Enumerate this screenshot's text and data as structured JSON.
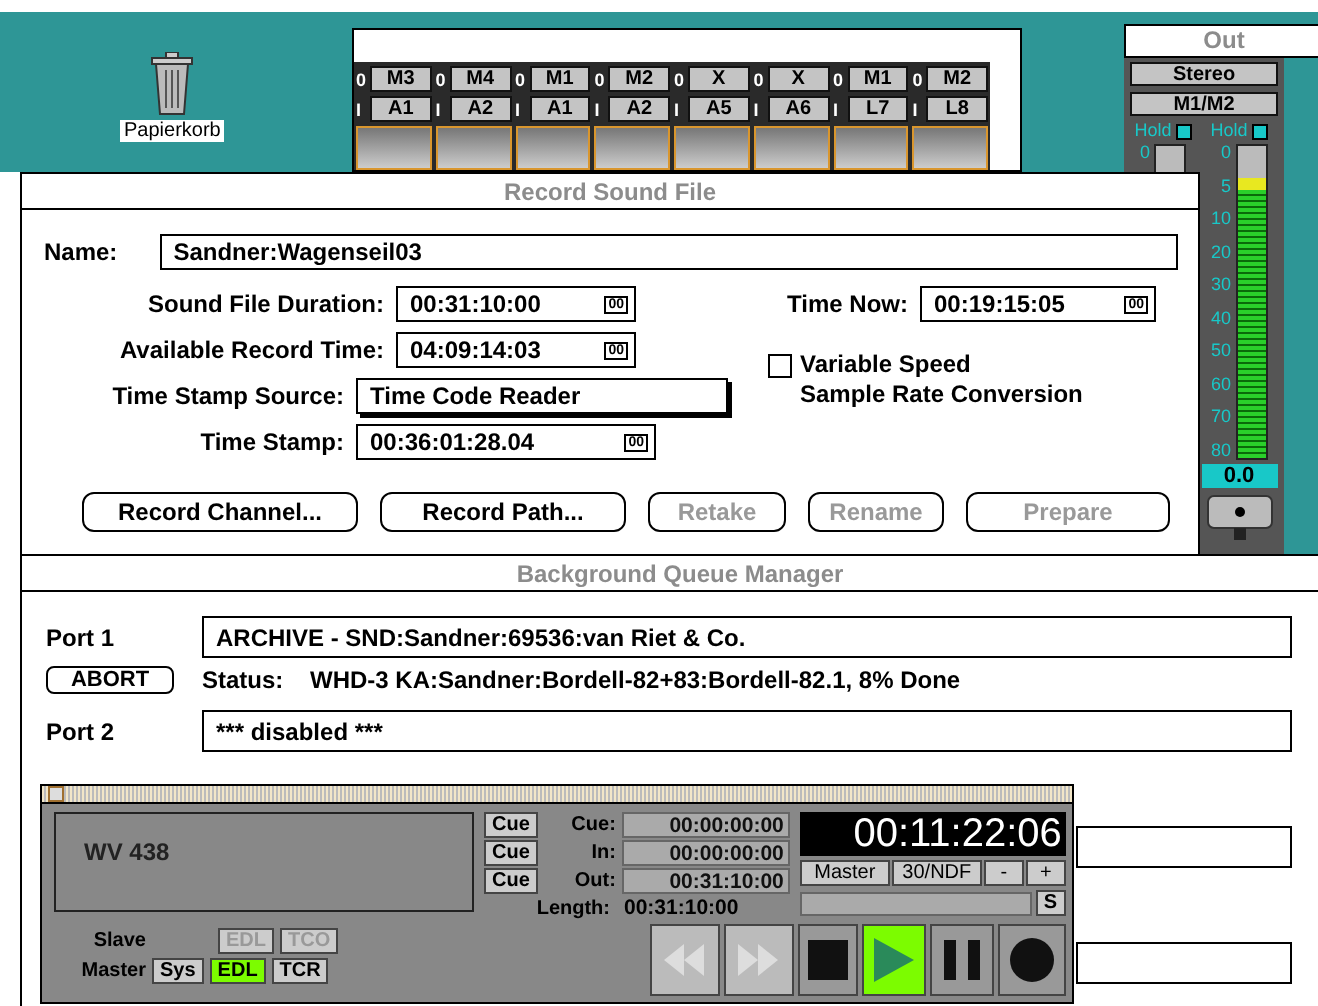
{
  "desktop": {
    "trash_label": "Papierkorb"
  },
  "mixer": {
    "strips": [
      {
        "out_tag": "0",
        "out": "M3",
        "in_tag": "I",
        "in": "A1"
      },
      {
        "out_tag": "0",
        "out": "M4",
        "in_tag": "I",
        "in": "A2"
      },
      {
        "out_tag": "0",
        "out": "M1",
        "in_tag": "I",
        "in": "A1"
      },
      {
        "out_tag": "0",
        "out": "M2",
        "in_tag": "I",
        "in": "A2"
      },
      {
        "out_tag": "0",
        "out": "X",
        "in_tag": "I",
        "in": "A5"
      },
      {
        "out_tag": "0",
        "out": "X",
        "in_tag": "I",
        "in": "A6"
      },
      {
        "out_tag": "0",
        "out": "M1",
        "in_tag": "I",
        "in": "L7"
      },
      {
        "out_tag": "0",
        "out": "M2",
        "in_tag": "I",
        "in": "L8"
      }
    ]
  },
  "out_panel": {
    "title": "Out",
    "buttons": [
      "Stereo",
      "M1/M2"
    ],
    "meters": [
      {
        "hold": "Hold",
        "scale": [
          "0"
        ]
      },
      {
        "hold": "Hold",
        "scale": [
          "0",
          "5",
          "10",
          "20",
          "30",
          "40",
          "50",
          "60",
          "70",
          "80"
        ],
        "level": 0.9
      }
    ],
    "reading": "0.0"
  },
  "record_window": {
    "title": "Record Sound File",
    "name_label": "Name:",
    "name_value": "Sandner:Wagenseil03",
    "duration": {
      "label": "Sound File Duration:",
      "value": "00:31:10:00",
      "suffix": "00"
    },
    "time_now": {
      "label": "Time Now:",
      "value": "00:19:15:05",
      "suffix": "00"
    },
    "available": {
      "label": "Available Record Time:",
      "value": "04:09:14:03",
      "suffix": "00"
    },
    "source": {
      "label": "Time Stamp Source:",
      "value": "Time Code Reader"
    },
    "stamp": {
      "label": "Time Stamp:",
      "value": "00:36:01:28.04",
      "suffix": "00"
    },
    "variable_speed": {
      "label": "Variable Speed",
      "label_2": "Sample Rate Conversion",
      "checked": false
    },
    "buttons": [
      {
        "label": "Record Channel...",
        "disabled": false
      },
      {
        "label": "Record Path...",
        "disabled": false
      },
      {
        "label": "Retake",
        "disabled": true
      },
      {
        "label": "Rename",
        "disabled": true
      },
      {
        "label": "Prepare",
        "disabled": true
      }
    ]
  },
  "queue_window": {
    "title": "Background Queue Manager",
    "ports": [
      {
        "kind": "full",
        "label": "Port 1",
        "job": "ARCHIVE - SND:Sandner:69536:van Riet & Co.",
        "abort": "ABORT",
        "status_label": "Status:",
        "status": "WHD-3 KA:Sandner:Bordell-82+83:Bordell-82.1, 8% Done"
      },
      {
        "kind": "partial",
        "label": "Port 2",
        "job": "*** disabled ***"
      },
      {
        "kind": "covered"
      },
      {
        "kind": "covered"
      }
    ]
  },
  "transport": {
    "display_text": "WV 438",
    "cue_rows": [
      {
        "button": "Cue",
        "label": "Cue:",
        "value": "00:00:00:00"
      },
      {
        "button": "Cue",
        "label": "In:",
        "value": "00:00:00:00"
      },
      {
        "button": "Cue",
        "label": "Out:",
        "value": "00:31:10:00"
      }
    ],
    "length": {
      "label": "Length:",
      "value": "00:31:10:00"
    },
    "timecode": "00:11:22:06",
    "controls": [
      "Master",
      "30/NDF",
      "-",
      "+"
    ],
    "s_button": "S",
    "sync_rows": [
      {
        "label": "Slave",
        "buttons": [
          {
            "label": "EDL",
            "disabled": true,
            "selected": false
          },
          {
            "label": "TCO",
            "disabled": true,
            "selected": false
          }
        ]
      },
      {
        "label": "Master",
        "buttons": [
          {
            "label": "Sys",
            "disabled": false,
            "selected": false
          },
          {
            "label": "EDL",
            "disabled": false,
            "selected": true
          },
          {
            "label": "TCR",
            "disabled": false,
            "selected": false
          }
        ]
      }
    ],
    "deck": [
      {
        "kind": "rewind",
        "active": false,
        "disabled": true
      },
      {
        "kind": "forward",
        "active": false,
        "disabled": true
      },
      {
        "kind": "stop",
        "active": false,
        "disabled": false
      },
      {
        "kind": "play",
        "active": true,
        "disabled": false
      },
      {
        "kind": "pause",
        "active": false,
        "disabled": false
      },
      {
        "kind": "record",
        "active": false,
        "disabled": false
      }
    ]
  }
}
